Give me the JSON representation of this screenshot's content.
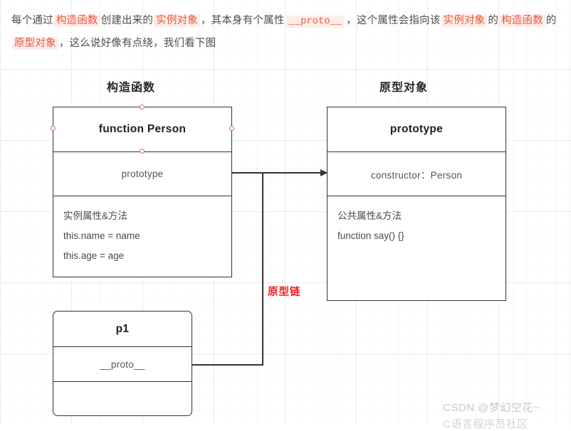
{
  "intro": {
    "segments": [
      {
        "text": "每个通过",
        "style": "plain"
      },
      {
        "text": "构造函数",
        "style": "hl"
      },
      {
        "text": "创建出来的",
        "style": "plain"
      },
      {
        "text": "实例对象",
        "style": "hl"
      },
      {
        "text": "，其本身有个属性",
        "style": "plain"
      },
      {
        "text": "__proto__",
        "style": "code"
      },
      {
        "text": "，这个属性会指向该",
        "style": "plain"
      },
      {
        "text": "实例对象",
        "style": "hl"
      },
      {
        "text": "的",
        "style": "plain"
      },
      {
        "text": "构造函数",
        "style": "hl"
      },
      {
        "text": "的",
        "style": "plain"
      },
      {
        "text": "原型对象",
        "style": "hl"
      },
      {
        "text": "，这么说好像有点绕，我们看下图",
        "style": "plain"
      }
    ],
    "line1_part_a": "每个通过",
    "line1_hl_1": "构造函数",
    "line1_part_b": "创建出来的",
    "line1_hl_2": "实例对象",
    "line1_part_c": "，其本身有个属性",
    "line1_code": "__proto__",
    "line1_part_d": "，这个属性会指向该",
    "line1_hl_3": "实例对象",
    "line1_part_e": "的",
    "line1_hl_4": "构造函数",
    "line2_part_a": "的",
    "line2_hl_1": "原型对象",
    "line2_part_b": "，这么说好像有点绕，我们看下图"
  },
  "diagram": {
    "titles": {
      "constructor": "构造函数",
      "prototype": "原型对象"
    },
    "chain_label": "原型链",
    "person_box": {
      "header": "function Person",
      "member": "prototype",
      "body_title": "实例属性&方法",
      "body_line_1": "this.name = name",
      "body_line_2": "this.age = age"
    },
    "prototype_box": {
      "header": "prototype",
      "member": "constructor：Person",
      "body_title": "公共属性&方法",
      "body_line_1": "function say() {}"
    },
    "p1_box": {
      "header": "p1",
      "member": "__proto__",
      "body": ""
    },
    "colors": {
      "highlight_text": "#e8553a",
      "highlight_bg": "#fdeeeb",
      "chain_label": "#fb1919",
      "box_border": "#333333",
      "handle": "#d06a74",
      "watermark": "#c9c9c9"
    }
  },
  "watermark": {
    "line1": "CSDN @梦幻空花~",
    "line2": "C语言程序员社区"
  }
}
